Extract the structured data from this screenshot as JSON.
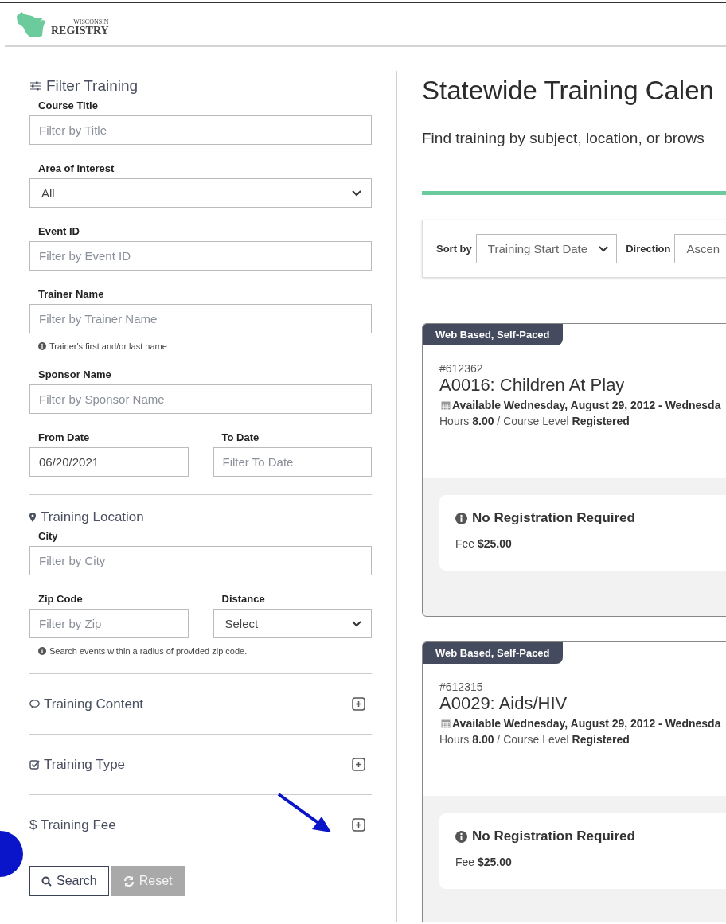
{
  "logo": {
    "top": "WISCONSIN",
    "bottom": "REGISTRY"
  },
  "filter": {
    "title": "Filter Training",
    "rows": [
      {
        "kind": "single",
        "fields": [
          {
            "kind": "input",
            "label": "Course Title",
            "placeholder": "Filter by Title"
          }
        ]
      },
      {
        "kind": "single",
        "fields": [
          {
            "kind": "select",
            "label": "Area of Interest",
            "value": "All"
          }
        ]
      },
      {
        "kind": "single",
        "fields": [
          {
            "kind": "input",
            "label": "Event ID",
            "placeholder": "Filter by Event ID"
          }
        ]
      },
      {
        "kind": "single",
        "fields": [
          {
            "kind": "input",
            "label": "Trainer Name",
            "placeholder": "Filter by Trainer Name"
          }
        ],
        "hint": "Trainer's first and/or last name"
      },
      {
        "kind": "single",
        "fields": [
          {
            "kind": "input",
            "label": "Sponsor Name",
            "placeholder": "Filter by Sponsor Name"
          }
        ]
      },
      {
        "kind": "pair",
        "fields": [
          {
            "kind": "input",
            "label": "From Date",
            "value": "06/20/2021"
          },
          {
            "kind": "input",
            "label": "To Date",
            "placeholder": "Filter To Date"
          }
        ]
      }
    ]
  },
  "location": {
    "title": "Training Location",
    "rows": [
      {
        "kind": "single",
        "fields": [
          {
            "kind": "input",
            "label": "City",
            "placeholder": "Filter by City"
          }
        ]
      },
      {
        "kind": "pair",
        "fields": [
          {
            "kind": "input",
            "label": "Zip Code",
            "placeholder": "Filter by Zip"
          },
          {
            "kind": "select",
            "label": "Distance",
            "value": "Select"
          }
        ],
        "hint": "Search events within a radius of provided zip code."
      }
    ]
  },
  "sections": [
    {
      "title": "Training Content",
      "expanded": false
    },
    {
      "title": "Training Type",
      "expanded": false
    },
    {
      "title": "$ Training Fee",
      "expanded": false
    }
  ],
  "actions": [
    {
      "label": "Search",
      "disabled": false
    },
    {
      "label": "Reset",
      "disabled": true
    }
  ],
  "main": {
    "title": "Statewide Training Calen",
    "subtitle": "Find training by subject, location, or brows",
    "sort": {
      "label": "Sort by",
      "value": "Training Start Date"
    },
    "direction": {
      "label": "Direction",
      "value": "Ascen"
    }
  },
  "events": [
    {
      "tag": "Web Based, Self-Paced",
      "id": "#612362",
      "title": "A0016: Children At Play",
      "date": "Available Wednesday, August 29, 2012 - Wednesda",
      "details": "Hours **8.00** / Course Level **Registered**",
      "registration": "No Registration Required",
      "fee": "Fee **$25.00**"
    },
    {
      "tag": "Web Based, Self-Paced",
      "id": "#612315",
      "title": "A0029: Aids/HIV",
      "date": "Available Wednesday, August 29, 2012 - Wednesda",
      "details": "Hours **8.00** / Course Level **Registered**",
      "registration": "No Registration Required",
      "fee": "Fee **$25.00**"
    }
  ]
}
